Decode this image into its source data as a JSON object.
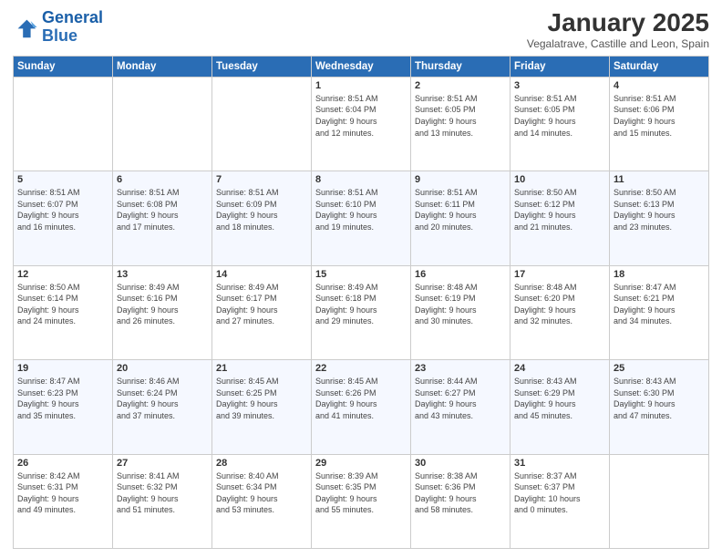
{
  "logo": {
    "line1": "General",
    "line2": "Blue"
  },
  "header": {
    "month_title": "January 2025",
    "subtitle": "Vegalatrave, Castille and Leon, Spain"
  },
  "weekdays": [
    "Sunday",
    "Monday",
    "Tuesday",
    "Wednesday",
    "Thursday",
    "Friday",
    "Saturday"
  ],
  "weeks": [
    [
      {
        "day": "",
        "info": ""
      },
      {
        "day": "",
        "info": ""
      },
      {
        "day": "",
        "info": ""
      },
      {
        "day": "1",
        "info": "Sunrise: 8:51 AM\nSunset: 6:04 PM\nDaylight: 9 hours\nand 12 minutes."
      },
      {
        "day": "2",
        "info": "Sunrise: 8:51 AM\nSunset: 6:05 PM\nDaylight: 9 hours\nand 13 minutes."
      },
      {
        "day": "3",
        "info": "Sunrise: 8:51 AM\nSunset: 6:05 PM\nDaylight: 9 hours\nand 14 minutes."
      },
      {
        "day": "4",
        "info": "Sunrise: 8:51 AM\nSunset: 6:06 PM\nDaylight: 9 hours\nand 15 minutes."
      }
    ],
    [
      {
        "day": "5",
        "info": "Sunrise: 8:51 AM\nSunset: 6:07 PM\nDaylight: 9 hours\nand 16 minutes."
      },
      {
        "day": "6",
        "info": "Sunrise: 8:51 AM\nSunset: 6:08 PM\nDaylight: 9 hours\nand 17 minutes."
      },
      {
        "day": "7",
        "info": "Sunrise: 8:51 AM\nSunset: 6:09 PM\nDaylight: 9 hours\nand 18 minutes."
      },
      {
        "day": "8",
        "info": "Sunrise: 8:51 AM\nSunset: 6:10 PM\nDaylight: 9 hours\nand 19 minutes."
      },
      {
        "day": "9",
        "info": "Sunrise: 8:51 AM\nSunset: 6:11 PM\nDaylight: 9 hours\nand 20 minutes."
      },
      {
        "day": "10",
        "info": "Sunrise: 8:50 AM\nSunset: 6:12 PM\nDaylight: 9 hours\nand 21 minutes."
      },
      {
        "day": "11",
        "info": "Sunrise: 8:50 AM\nSunset: 6:13 PM\nDaylight: 9 hours\nand 23 minutes."
      }
    ],
    [
      {
        "day": "12",
        "info": "Sunrise: 8:50 AM\nSunset: 6:14 PM\nDaylight: 9 hours\nand 24 minutes."
      },
      {
        "day": "13",
        "info": "Sunrise: 8:49 AM\nSunset: 6:16 PM\nDaylight: 9 hours\nand 26 minutes."
      },
      {
        "day": "14",
        "info": "Sunrise: 8:49 AM\nSunset: 6:17 PM\nDaylight: 9 hours\nand 27 minutes."
      },
      {
        "day": "15",
        "info": "Sunrise: 8:49 AM\nSunset: 6:18 PM\nDaylight: 9 hours\nand 29 minutes."
      },
      {
        "day": "16",
        "info": "Sunrise: 8:48 AM\nSunset: 6:19 PM\nDaylight: 9 hours\nand 30 minutes."
      },
      {
        "day": "17",
        "info": "Sunrise: 8:48 AM\nSunset: 6:20 PM\nDaylight: 9 hours\nand 32 minutes."
      },
      {
        "day": "18",
        "info": "Sunrise: 8:47 AM\nSunset: 6:21 PM\nDaylight: 9 hours\nand 34 minutes."
      }
    ],
    [
      {
        "day": "19",
        "info": "Sunrise: 8:47 AM\nSunset: 6:23 PM\nDaylight: 9 hours\nand 35 minutes."
      },
      {
        "day": "20",
        "info": "Sunrise: 8:46 AM\nSunset: 6:24 PM\nDaylight: 9 hours\nand 37 minutes."
      },
      {
        "day": "21",
        "info": "Sunrise: 8:45 AM\nSunset: 6:25 PM\nDaylight: 9 hours\nand 39 minutes."
      },
      {
        "day": "22",
        "info": "Sunrise: 8:45 AM\nSunset: 6:26 PM\nDaylight: 9 hours\nand 41 minutes."
      },
      {
        "day": "23",
        "info": "Sunrise: 8:44 AM\nSunset: 6:27 PM\nDaylight: 9 hours\nand 43 minutes."
      },
      {
        "day": "24",
        "info": "Sunrise: 8:43 AM\nSunset: 6:29 PM\nDaylight: 9 hours\nand 45 minutes."
      },
      {
        "day": "25",
        "info": "Sunrise: 8:43 AM\nSunset: 6:30 PM\nDaylight: 9 hours\nand 47 minutes."
      }
    ],
    [
      {
        "day": "26",
        "info": "Sunrise: 8:42 AM\nSunset: 6:31 PM\nDaylight: 9 hours\nand 49 minutes."
      },
      {
        "day": "27",
        "info": "Sunrise: 8:41 AM\nSunset: 6:32 PM\nDaylight: 9 hours\nand 51 minutes."
      },
      {
        "day": "28",
        "info": "Sunrise: 8:40 AM\nSunset: 6:34 PM\nDaylight: 9 hours\nand 53 minutes."
      },
      {
        "day": "29",
        "info": "Sunrise: 8:39 AM\nSunset: 6:35 PM\nDaylight: 9 hours\nand 55 minutes."
      },
      {
        "day": "30",
        "info": "Sunrise: 8:38 AM\nSunset: 6:36 PM\nDaylight: 9 hours\nand 58 minutes."
      },
      {
        "day": "31",
        "info": "Sunrise: 8:37 AM\nSunset: 6:37 PM\nDaylight: 10 hours\nand 0 minutes."
      },
      {
        "day": "",
        "info": ""
      }
    ]
  ]
}
